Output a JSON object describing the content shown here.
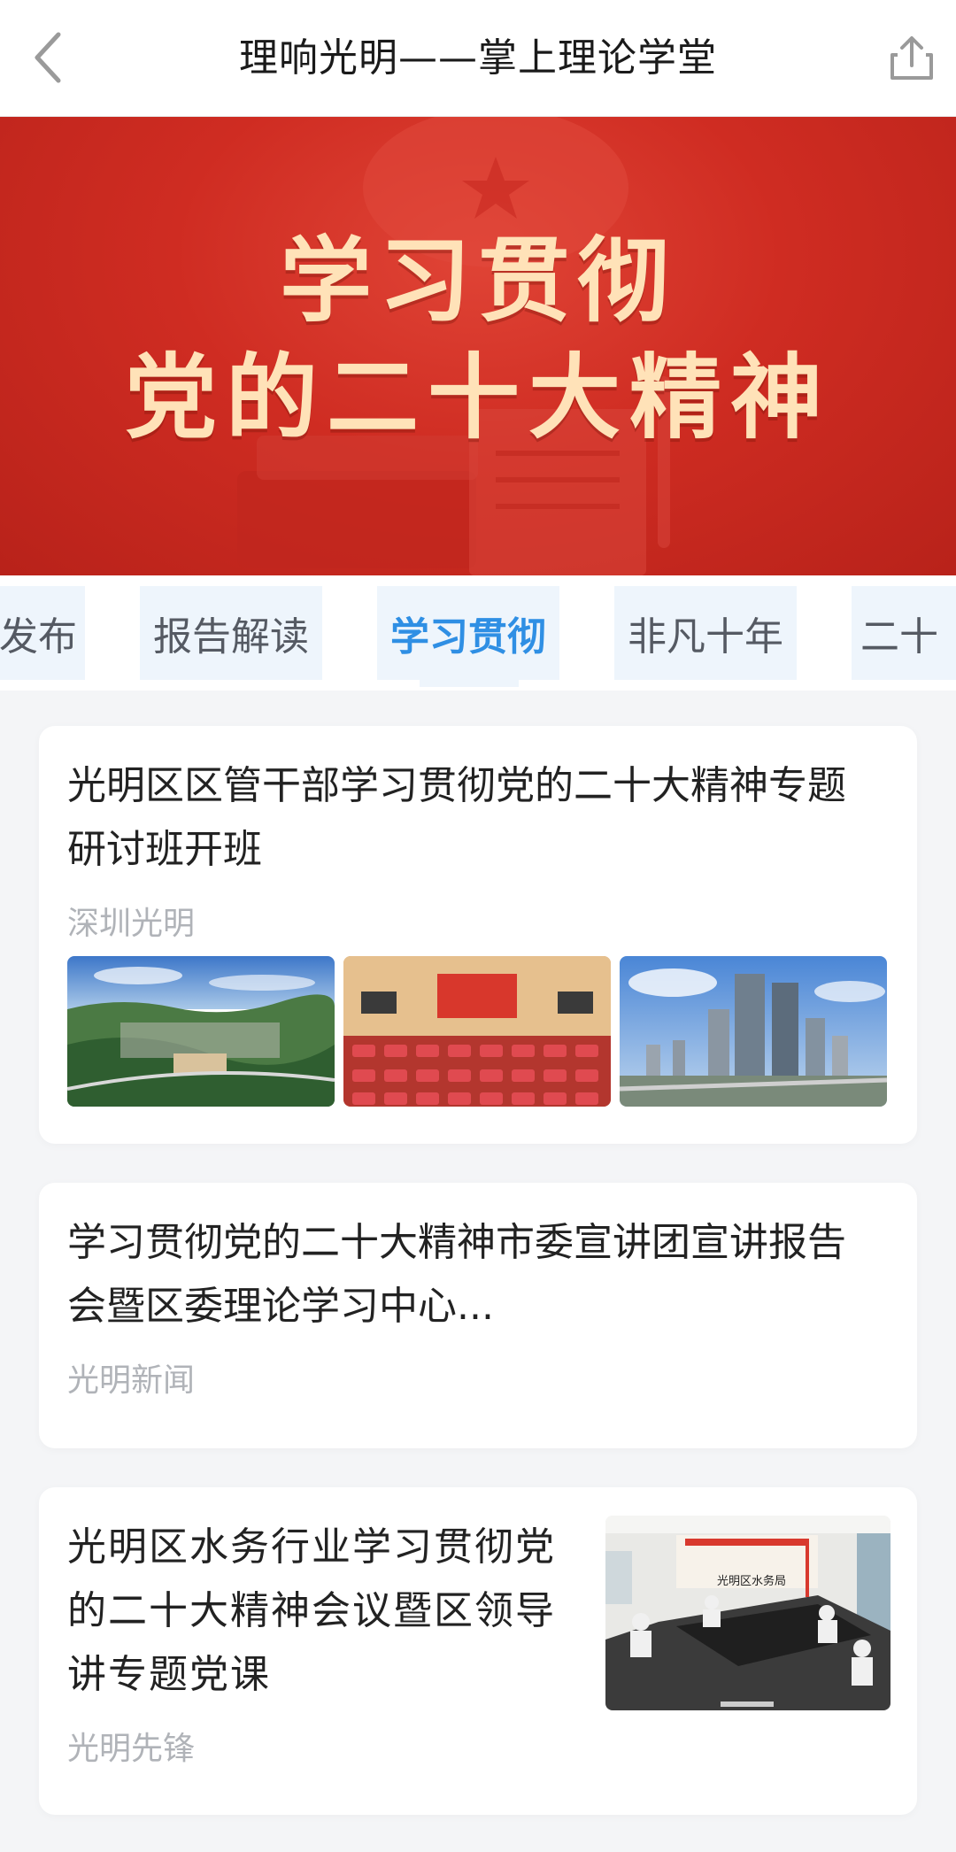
{
  "header": {
    "title": "理响光明——掌上理论学堂",
    "back_icon": "chevron-left-icon",
    "share_icon": "share-icon"
  },
  "banner": {
    "line1": "学习贯彻",
    "line2": "党的二十大精神",
    "text_color": "#ffe2b8",
    "background_color": "#cf2c22"
  },
  "tabs": {
    "items": [
      {
        "label": "发布"
      },
      {
        "label": "报告解读"
      },
      {
        "label": "学习贯彻"
      },
      {
        "label": "非凡十年"
      },
      {
        "label": "二十"
      }
    ],
    "active_index": 2,
    "active_color": "#2f8fe4"
  },
  "articles": [
    {
      "title_line1": "光明区区管干部学习贯彻党的二十大精神专题",
      "title_line2": "研讨班开班",
      "source": "深圳光明",
      "images": [
        "aerial-city-photo",
        "conference-hall-photo",
        "skyscrapers-photo"
      ]
    },
    {
      "title_line1": "学习贯彻党的二十大精神市委宣讲团宣讲报告",
      "title_line2": "会暨区委理论学习中心...",
      "source": "光明新闻"
    },
    {
      "title_line1": "光明区水务行业学习贯彻党",
      "title_line2": "的二十大精神会议暨区领导",
      "title_line3": "讲专题党课",
      "source": "光明先锋",
      "image": "meeting-room-photo",
      "image_sign": "光明区水务局"
    }
  ]
}
